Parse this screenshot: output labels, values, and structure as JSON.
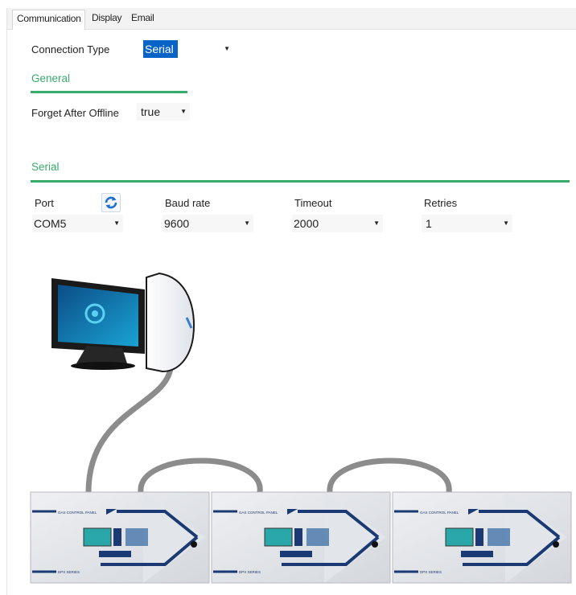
{
  "tabs": [
    "Communication",
    "Display",
    "Email"
  ],
  "connection_type": {
    "label": "Connection Type",
    "value": "Serial"
  },
  "general": {
    "title": "General",
    "forget_after_offline": {
      "label": "Forget After Offline",
      "value": "true"
    }
  },
  "serial": {
    "title": "Serial",
    "port": {
      "label": "Port",
      "value": "COM5"
    },
    "baud_rate": {
      "label": "Baud rate",
      "value": "9600"
    },
    "timeout": {
      "label": "Timeout",
      "value": "2000"
    },
    "retries": {
      "label": "Retries",
      "value": "1"
    }
  },
  "panel": {
    "title": "GAS CONTROL PANEL",
    "series": "DPX SERIES"
  },
  "colors": {
    "accent": "#3aaa6b",
    "selection": "#0a64c8",
    "cable": "#8c8c8c",
    "panel_blue": "#1b3a73"
  }
}
